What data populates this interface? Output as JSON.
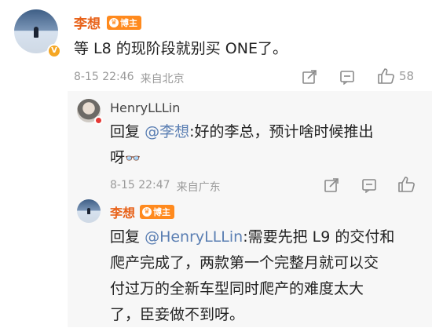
{
  "comment1": {
    "author": "李想",
    "badge": "博主",
    "verified_mark": "V",
    "text": "等 L8 的现阶段就别买 ONE了。",
    "date": "8-15 22:46",
    "location": "来自北京",
    "like_count": "58",
    "icons": [
      "share-icon",
      "comment-icon",
      "like-icon"
    ]
  },
  "reply1": {
    "author": "HenryLLLin",
    "prefix": "回复",
    "mention": "@李想",
    "text": ":好的李总，预计啥时候推出",
    "text2": "呀",
    "emoji": "👓",
    "date": "8-15 22:47",
    "location": "来自广东"
  },
  "reply2": {
    "author": "李想",
    "badge": "博主",
    "prefix": "回复",
    "mention": "@HenryLLLin",
    "line1": ":需要先把 L9 的交付和",
    "line2": "爬产完成了，两款第一个完整月就可以交",
    "line3": "付过万的全新车型同时爬产的难度太大",
    "line4": "了，臣妾做不到呀。"
  },
  "colors": {
    "orange_name": "#e8631b",
    "badge": "#ff8a1e",
    "mention": "#5b7fb3",
    "meta": "#9a9a9a"
  }
}
